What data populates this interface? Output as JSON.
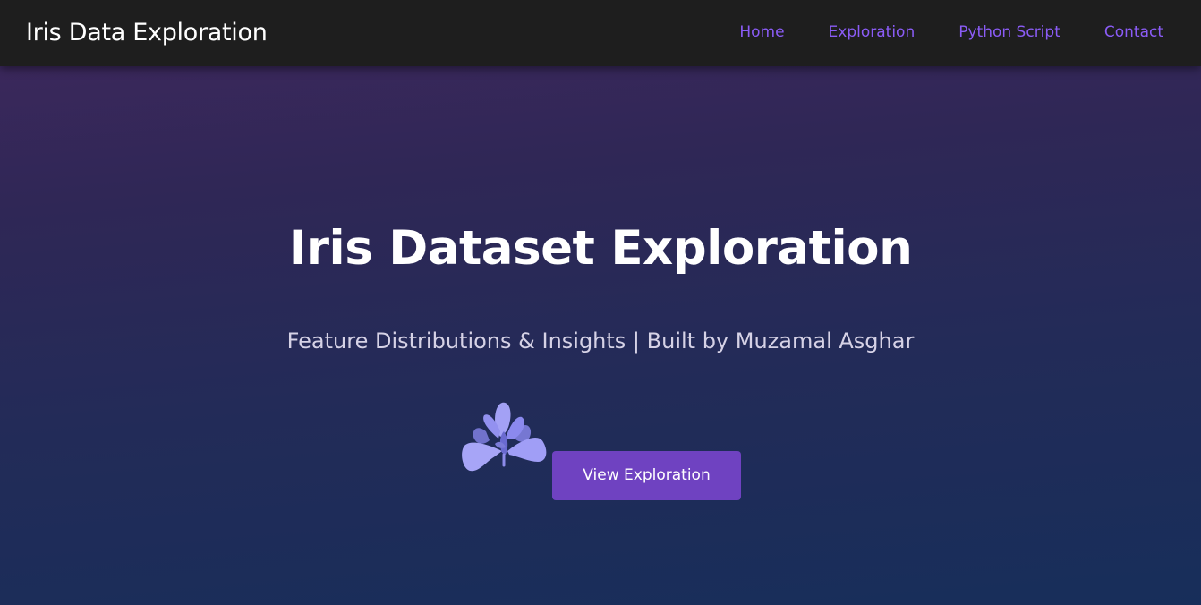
{
  "navbar": {
    "brand": "Iris Data Exploration",
    "links": [
      {
        "label": "Home"
      },
      {
        "label": "Exploration"
      },
      {
        "label": "Python Script"
      },
      {
        "label": "Contact"
      }
    ],
    "link_color": "#8b5cf6",
    "background": "#1e1e1e"
  },
  "hero": {
    "title": "Iris Dataset Exploration",
    "subtitle": "Feature Distributions & Insights | Built by Muzamal Asghar",
    "illustration_icon": "iris-flower-icon",
    "cta_label": "View Exploration",
    "cta_color": "#6f42c1"
  }
}
